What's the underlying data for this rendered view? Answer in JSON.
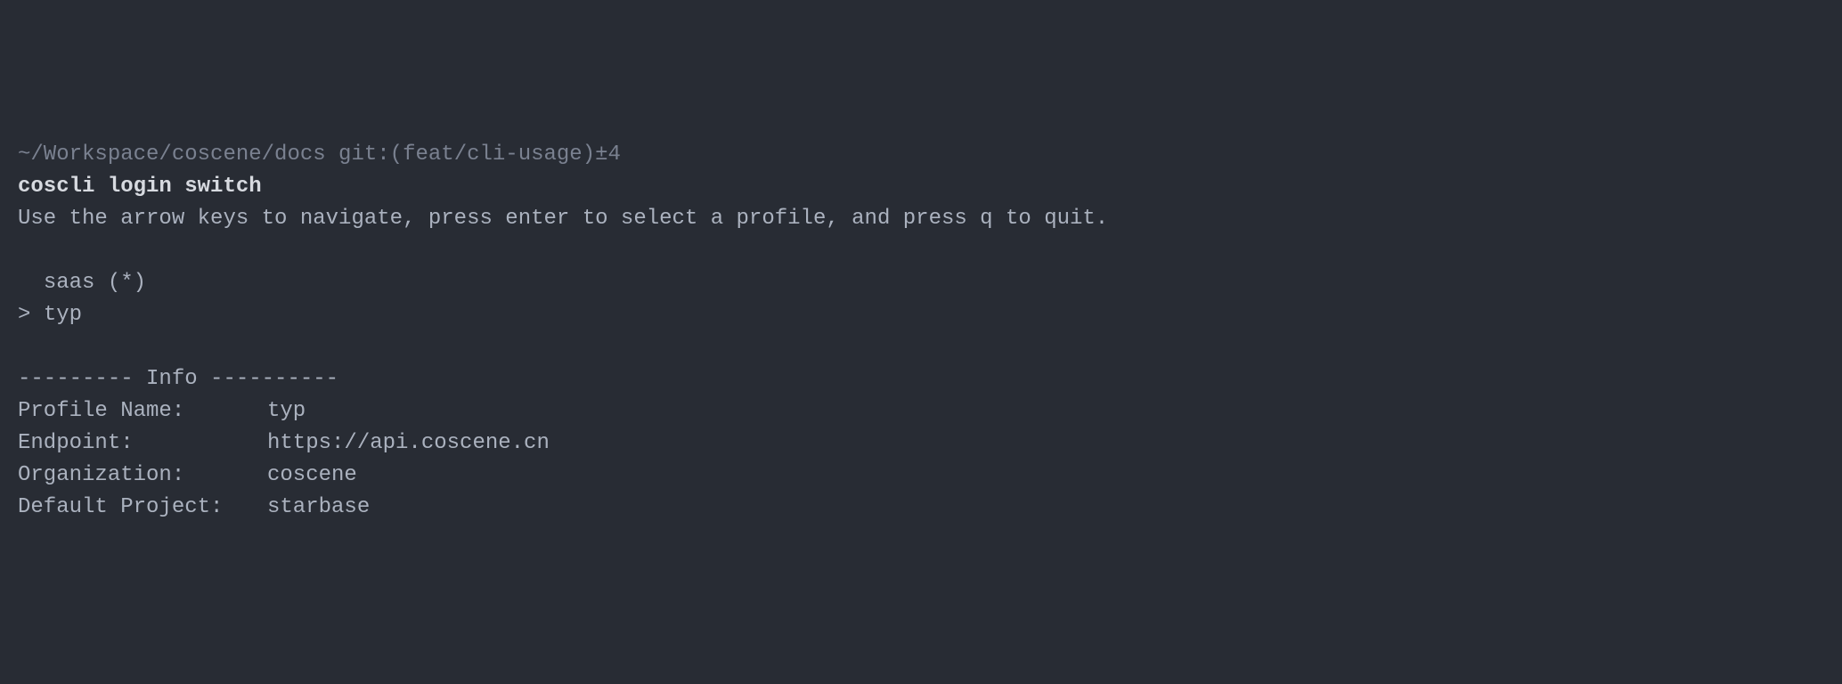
{
  "prompt": {
    "path": "~/Workspace/coscene/docs",
    "git_prefix": " git:(",
    "git_branch": "feat/cli-usage",
    "git_suffix": ")",
    "git_status": "±4"
  },
  "command": "coscli login switch",
  "instruction": "Use the arrow keys to navigate, press enter to select a profile, and press q to quit.",
  "profiles": {
    "item1_indent": "  ",
    "item1_name": "saas (*)",
    "cursor": "> ",
    "item2_name": "typ"
  },
  "info": {
    "header": "--------- Info ----------",
    "rows": {
      "profile_label": "Profile Name:",
      "profile_value": "typ",
      "endpoint_label": "Endpoint:",
      "endpoint_value": "https://api.coscene.cn",
      "org_label": "Organization:",
      "org_value": "coscene",
      "project_label": "Default Project:",
      "project_value": "starbase"
    }
  }
}
